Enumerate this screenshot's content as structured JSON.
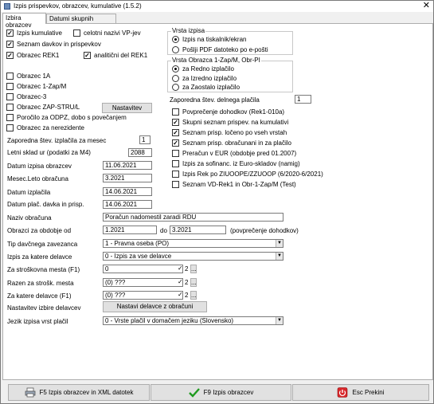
{
  "window": {
    "title": "Izpis prispevkov, obrazcev, kumulative  (1.5.2)",
    "close_glyph": "✕"
  },
  "tabs": [
    "Izbira obrazcev",
    "Datumi skupnih obrazcev"
  ],
  "left_checks": [
    {
      "label": "Izpis kumulative",
      "checked": true
    },
    {
      "label": "celotni nazivi VP-jev",
      "checked": false
    },
    {
      "label": "Seznam davkov in prispevkov",
      "checked": true
    },
    {
      "label": "Obrazec REK1",
      "checked": true
    },
    {
      "label": "analitični del REK1",
      "checked": true
    },
    {
      "label": "Obrazec 1A",
      "checked": false
    },
    {
      "label": "Obrazec 1-Zap/M",
      "checked": false
    },
    {
      "label": "Obrazec-3",
      "checked": false
    },
    {
      "label": "Obrazec ZAP-STRU/L",
      "checked": false
    },
    {
      "label": "Poročilo za ODPZ, dobo s povečanjem",
      "checked": false
    },
    {
      "label": "Obrazec za nerezidente",
      "checked": false
    }
  ],
  "settings_button": "Nastavitev",
  "vrsta_izpisa": {
    "legend": "Vrsta izpisa",
    "options": [
      {
        "label": "Izpis na tiskalnik/ekran",
        "selected": true
      },
      {
        "label": "Pošlji PDF datoteko po e-pošti",
        "selected": false
      }
    ]
  },
  "vrsta_obrazca": {
    "legend": "Vrsta  Obrazca 1-Zap/M, Obr-PI",
    "options": [
      {
        "label": "za Redno izplačilo",
        "selected": true
      },
      {
        "label": "za Izredno izplačilo",
        "selected": false
      },
      {
        "label": "za Zaostalo izplačilo",
        "selected": false
      }
    ]
  },
  "zaporedna_delnega": {
    "label": "Zaporedna štev. delnega plačila",
    "value": "1"
  },
  "right_checks": [
    {
      "label": "Povprečenje dohodkov (Rek1-010a)",
      "checked": false
    },
    {
      "label": "Skupni seznam prispev. na kumulativi",
      "checked": true
    },
    {
      "label": "Seznam prisp. ločeno po vseh vrstah",
      "checked": true
    },
    {
      "label": "Seznam prisp. obračunani in za plačilo",
      "checked": true
    },
    {
      "label": "Preračun v EUR (obdobje pred 01.2007)",
      "checked": false
    },
    {
      "label": "Izpis za sofinanc. iz Euro-skladov (namig)",
      "checked": false
    },
    {
      "label": "Izpis Rek po ZIUOOPE/ZZUOOP (6/2020-6/2021)",
      "checked": false
    },
    {
      "label": "Seznam VD-Rek1 in Obr-1-Zap/M (Test)",
      "checked": false
    }
  ],
  "fields": {
    "zaporedna_mesec": {
      "label": "Zaporedna štev. izplačila za mesec",
      "value": "1"
    },
    "letni_sklad": {
      "label": "Letni sklad ur (podatki za M4)",
      "value": "2088"
    },
    "datum_izpisa": {
      "label": "Datum izpisa obrazcev",
      "value": "11.06.2021"
    },
    "mesec_leto": {
      "label": "Mesec.Leto obračuna",
      "value": "3.2021"
    },
    "datum_izplacila": {
      "label": "Datum izplačila",
      "value": "14.06.2021"
    },
    "datum_placila_davka": {
      "label": "Datum plač. davka in prisp.",
      "value": "14.06.2021"
    },
    "naziv_obracuna": {
      "label": "Naziv obračuna",
      "value": "Poračun nadomestil zaradi RDU"
    },
    "obdobje": {
      "label": "Obrazci za obdobje od",
      "from": "1.2021",
      "do_label": "do",
      "to": "3.2021",
      "note": "(povprečenje dohodkov)"
    }
  },
  "selects": {
    "tip_zavezanca": {
      "label": "Tip davčnega zavezanca",
      "value": "1 - Pravna oseba (PO)"
    },
    "izpis_delavce": {
      "label": "Izpis za katere delavce",
      "value": "0 - Izpis za vse delavce"
    },
    "jezik": {
      "label": "Jezik izpisa vrst plačil",
      "value": "0 - Vrste plačil v domačem jeziku (Slovensko)"
    }
  },
  "filters": [
    {
      "label": "Za stroškovna mesta (F1)",
      "value": "0"
    },
    {
      "label": "Razen za strošk. mesta",
      "value": "(0) ???"
    },
    {
      "label": "Za katere delavce (F1)",
      "value": "(0) ???"
    }
  ],
  "filter_controls": {
    "check": "✓",
    "num": "2",
    "more": "..."
  },
  "nastavitev_delavcev": {
    "label": "Nastavitev izbire delavcev",
    "button": "Nastavi delavce z obračuni"
  },
  "footer": {
    "xml_button": "F5  Izpis obrazcev in XML datotek",
    "print_button": "F9  Izpis obrazcev",
    "exit_button": "Esc  Prekini"
  }
}
